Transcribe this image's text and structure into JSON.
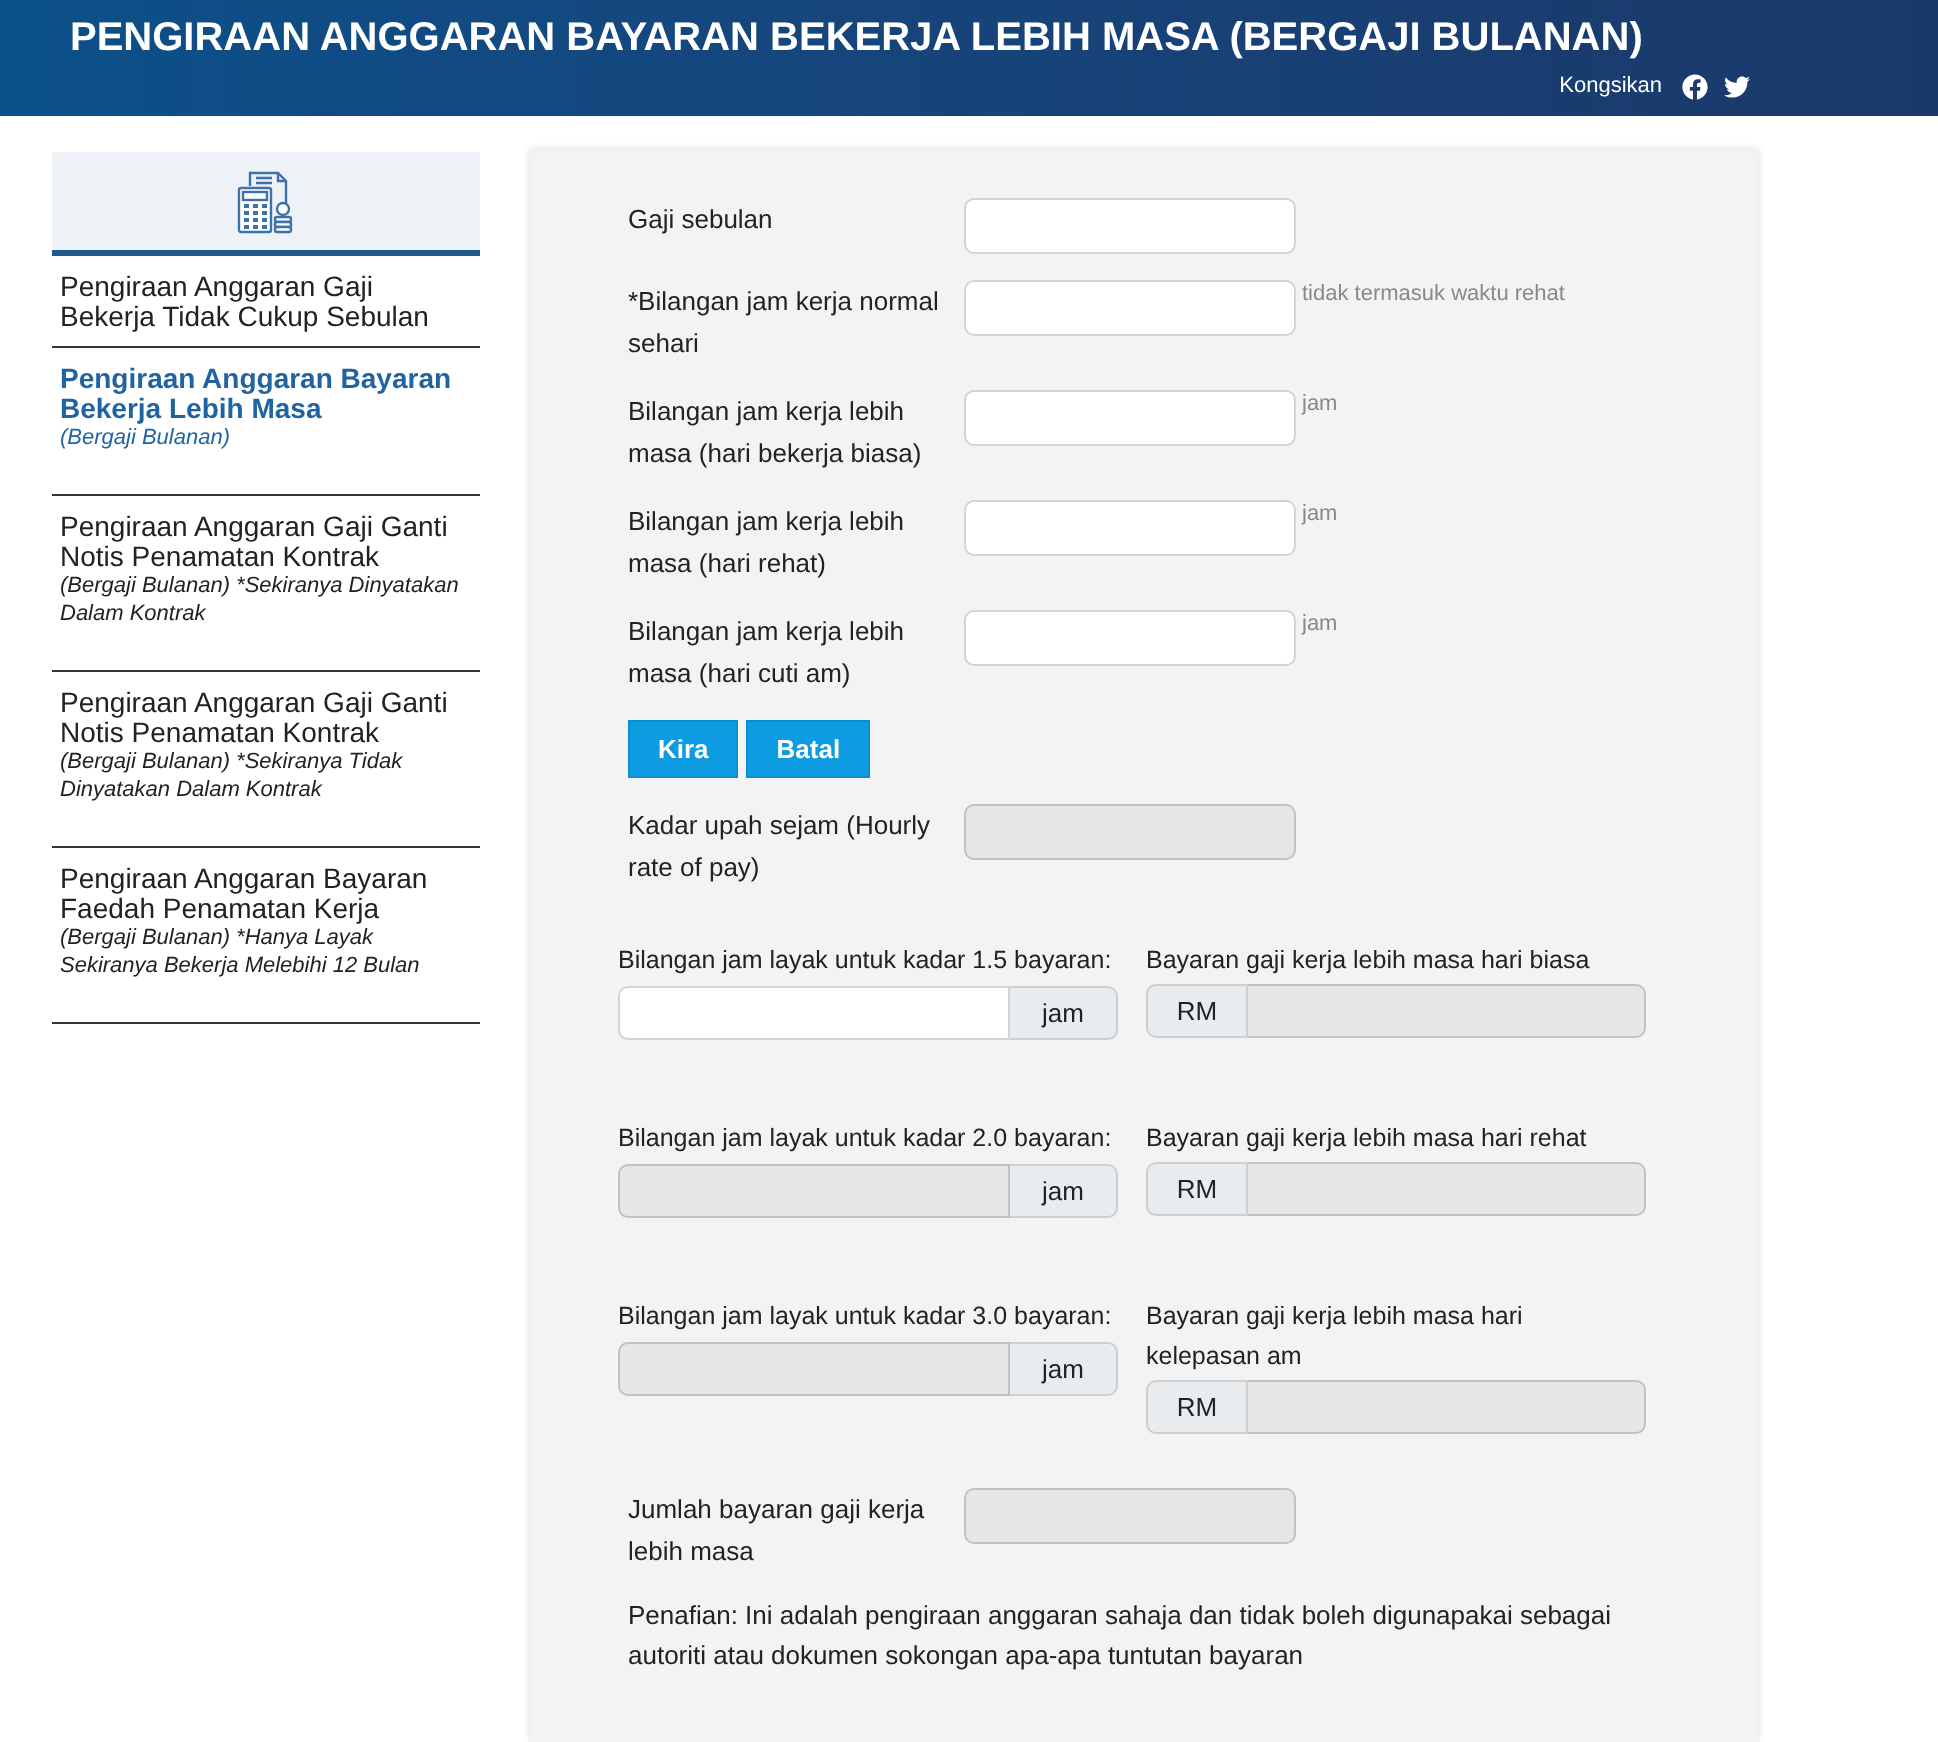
{
  "header": {
    "title": "PENGIRAAN ANGGARAN BAYARAN BEKERJA LEBIH MASA (BERGAJI BULANAN)",
    "share_label": "Kongsikan"
  },
  "sidebar": {
    "items": [
      {
        "title": "Pengiraan Anggaran Gaji Bekerja Tidak Cukup Sebulan",
        "selected": false
      },
      {
        "title": "Pengiraan Anggaran Bayaran Bekerja Lebih Masa",
        "subtitle": "(Bergaji Bulanan)",
        "selected": true
      },
      {
        "title": "Pengiraan Anggaran Gaji Ganti Notis Penamatan Kontrak",
        "subtitle": "(Bergaji Bulanan) *Sekiranya Dinyatakan Dalam Kontrak",
        "selected": false
      },
      {
        "title": "Pengiraan Anggaran Gaji Ganti Notis Penamatan Kontrak",
        "subtitle": "(Bergaji Bulanan) *Sekiranya Tidak Dinyatakan Dalam Kontrak",
        "selected": false
      },
      {
        "title": "Pengiraan Anggaran Bayaran Faedah Penamatan Kerja",
        "subtitle": "(Bergaji Bulanan) *Hanya Layak Sekiranya Bekerja Melebihi 12 Bulan",
        "selected": false
      }
    ]
  },
  "form": {
    "fields": [
      {
        "label": "Gaji sebulan",
        "disabled": false
      },
      {
        "label": "*Bilangan jam kerja normal sehari",
        "hint": "tidak termasuk waktu rehat",
        "disabled": false
      },
      {
        "label": "Bilangan jam kerja lebih masa (hari bekerja biasa)",
        "hint": "jam",
        "disabled": false
      },
      {
        "label": "Bilangan jam kerja lebih masa (hari rehat)",
        "hint": "jam",
        "disabled": false
      },
      {
        "label": "Bilangan jam kerja lebih masa (hari cuti am)",
        "hint": "jam",
        "disabled": false
      }
    ],
    "buttons": [
      "Kira",
      "Batal"
    ],
    "rate_field": {
      "label": "Kadar upah sejam (Hourly rate of pay)",
      "disabled": true
    },
    "rate_groups": [
      {
        "hours_label": "Bilangan jam layak untuk kadar 1.5 bayaran:",
        "hours_unit": "jam",
        "hours_disabled": false,
        "pay_label": "Bayaran gaji kerja lebih masa hari biasa",
        "pay_currency": "RM",
        "pay_disabled": true
      },
      {
        "hours_label": "Bilangan jam layak untuk kadar 2.0 bayaran:",
        "hours_unit": "jam",
        "hours_disabled": true,
        "pay_label": "Bayaran gaji kerja lebih masa hari rehat",
        "pay_currency": "RM",
        "pay_disabled": true
      },
      {
        "hours_label": "Bilangan jam layak untuk kadar 3.0 bayaran:",
        "hours_unit": "jam",
        "hours_disabled": true,
        "pay_label": "Bayaran gaji kerja lebih masa hari kelepasan am",
        "pay_currency": "RM",
        "pay_disabled": true
      }
    ],
    "total_field": {
      "label": "Jumlah bayaran gaji kerja lebih masa",
      "disabled": true
    },
    "disclaimer": "Penafian: Ini adalah pengiraan anggaran sahaja dan tidak boleh digunapakai sebagai autoriti atau dokumen sokongan apa-apa tuntutan bayaran"
  }
}
